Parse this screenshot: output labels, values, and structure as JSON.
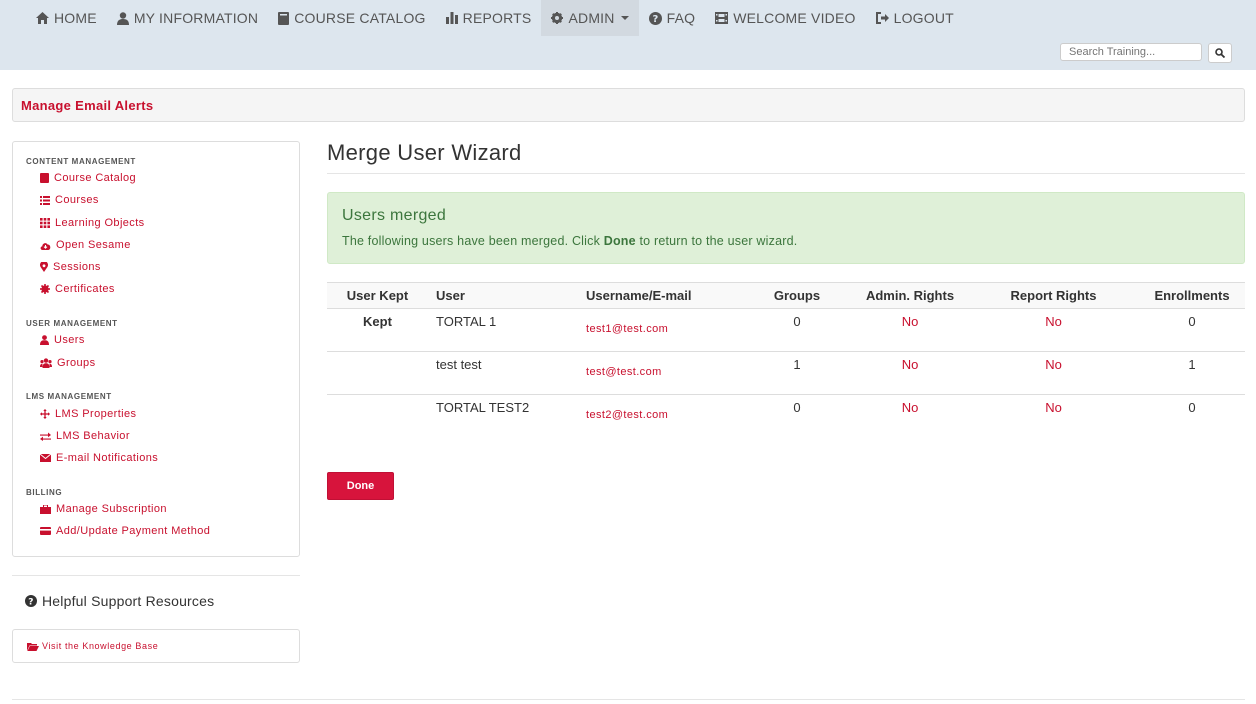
{
  "nav": {
    "home": "HOME",
    "my_information": "MY INFORMATION",
    "course_catalog": "COURSE CATALOG",
    "reports": "REPORTS",
    "admin": "ADMIN",
    "faq": "FAQ",
    "welcome_video": "WELCOME VIDEO",
    "logout": "LOGOUT"
  },
  "search": {
    "placeholder": "Search Training..."
  },
  "alert_bar": {
    "link": "Manage Email Alerts"
  },
  "sidebar": {
    "content_management": {
      "title": "CONTENT MANAGEMENT",
      "items": [
        "Course Catalog",
        "Courses",
        "Learning Objects",
        "Open Sesame",
        "Sessions",
        "Certificates"
      ]
    },
    "user_management": {
      "title": "USER MANAGEMENT",
      "items": [
        "Users",
        "Groups"
      ]
    },
    "lms_management": {
      "title": "LMS MANAGEMENT",
      "items": [
        "LMS Properties",
        "LMS Behavior",
        "E-mail Notifications"
      ]
    },
    "billing": {
      "title": "BILLING",
      "items": [
        "Manage Subscription",
        "Add/Update Payment Method"
      ]
    }
  },
  "help": {
    "title": "Helpful Support Resources",
    "kb_link": "Visit the Knowledge Base"
  },
  "main": {
    "title": "Merge User Wizard",
    "success": {
      "heading": "Users merged",
      "text_before": "The following users have been merged. Click ",
      "text_bold": "Done",
      "text_after": " to return to the user wizard."
    },
    "table": {
      "headers": [
        "User Kept",
        "User",
        "Username/E-mail",
        "Groups",
        "Admin. Rights",
        "Report Rights",
        "Enrollments"
      ],
      "rows": [
        {
          "kept": "Kept",
          "user": "TORTAL 1",
          "email": "test1@test.com",
          "groups": "0",
          "admin": "No",
          "report": "No",
          "enrollments": "0"
        },
        {
          "kept": "",
          "user": "test test",
          "email": "test@test.com",
          "groups": "1",
          "admin": "No",
          "report": "No",
          "enrollments": "1"
        },
        {
          "kept": "",
          "user": "TORTAL TEST2",
          "email": "test2@test.com",
          "groups": "0",
          "admin": "No",
          "report": "No",
          "enrollments": "0"
        }
      ]
    },
    "done_button": "Done"
  },
  "colors": {
    "accent": "#c8102e",
    "button": "#d7143c",
    "success_bg": "#dff0d8",
    "success_text": "#3c763d",
    "topbar": "#dde6ee"
  }
}
